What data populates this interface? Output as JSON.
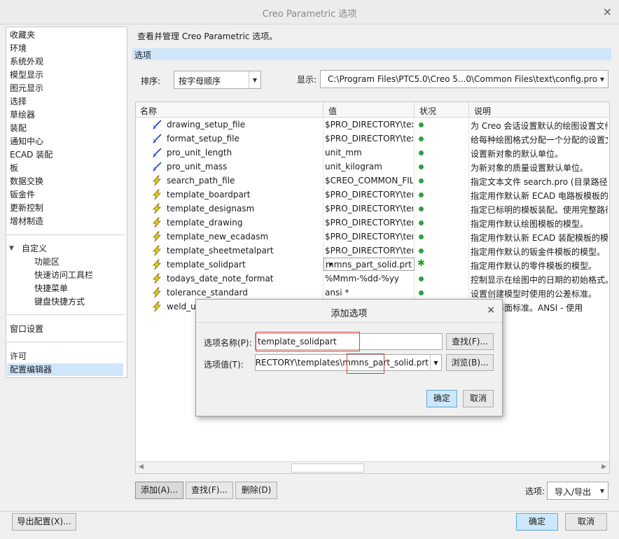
{
  "window": {
    "title": "Creo Parametric 选项",
    "close": "×"
  },
  "nav": {
    "items": [
      "收藏夹",
      "环境",
      "系统外观",
      "模型显示",
      "图元显示",
      "选择",
      "草绘器",
      "装配",
      "通知中心",
      "ECAD 装配",
      "板",
      "数据交换",
      "钣金件",
      "更新控制",
      "增材制造"
    ],
    "custom_group": "自定义",
    "custom_items": [
      "功能区",
      "快速访问工具栏",
      "快捷菜单",
      "键盘快捷方式"
    ],
    "window_settings": "窗口设置",
    "license": "许可",
    "config_editor": "配置编辑器"
  },
  "header": {
    "description": "查看并管理 Creo Parametric 选项。",
    "section": "选项",
    "sort_label": "排序:",
    "sort_value": "按字母顺序",
    "show_label": "显示:",
    "show_value": "C:\\Program Files\\PTC5.0\\Creo 5...0\\Common Files\\text\\config.pro"
  },
  "table": {
    "columns": [
      "名称",
      "值",
      "状况",
      "说明"
    ],
    "rows": [
      {
        "icon": "brush-icon",
        "name": "drawing_setup_file",
        "value": "$PRO_DIRECTORY\\tex",
        "desc": "为 Creo 会话设置默认的绘图设置文件"
      },
      {
        "icon": "brush-icon",
        "name": "format_setup_file",
        "value": "$PRO_DIRECTORY\\tex",
        "desc": "给每种绘图格式分配一个分配的设置文件"
      },
      {
        "icon": "brush-icon",
        "name": "pro_unit_length",
        "value": "unit_mm",
        "desc": "设置新对象的默认单位。"
      },
      {
        "icon": "brush-icon",
        "name": "pro_unit_mass",
        "value": "unit_kilogram",
        "desc": "为新对象的质量设置默认单位。"
      },
      {
        "icon": "lightning-icon",
        "name": "search_path_file",
        "value": "$CREO_COMMON_FIL",
        "desc": "指定文本文件 search.pro (目录路径"
      },
      {
        "icon": "lightning-icon",
        "name": "template_boardpart",
        "value": "$PRO_DIRECTORY\\ten",
        "desc": "指定用作默认新 ECAD 电路板模板的"
      },
      {
        "icon": "lightning-icon",
        "name": "template_designasm",
        "value": "$PRO_DIRECTORY\\ten",
        "desc": "指定已标明的模板装配。使用完整路径"
      },
      {
        "icon": "lightning-icon",
        "name": "template_drawing",
        "value": "$PRO_DIRECTORY\\ten",
        "desc": "指定用作默认绘图模板的模型。"
      },
      {
        "icon": "lightning-icon",
        "name": "template_new_ecadasm",
        "value": "$PRO_DIRECTORY\\ten",
        "desc": "指定用作默认新 ECAD 装配模板的模"
      },
      {
        "icon": "lightning-icon",
        "name": "template_sheetmetalpart",
        "value": "$PRO_DIRECTORY\\ten",
        "desc": "指定用作默认的钣金件模板的模型。"
      },
      {
        "icon": "lightning-icon",
        "name": "template_solidpart",
        "value": "mmns_part_solid.prt",
        "desc": "指定用作默认的零件模板的模型。",
        "editing": true
      },
      {
        "icon": "lightning-icon",
        "name": "todays_date_note_format",
        "value": "%Mmm-%dd-%yy",
        "desc": "控制显示在绘图中的日期的初始格式。"
      },
      {
        "icon": "lightning-icon",
        "name": "tolerance_standard",
        "value": "ansi *",
        "desc": "设置创建模型时使用的公差标准。"
      },
      {
        "icon": "lightning-icon",
        "name": "weld_ui",
        "value": "",
        "desc": "使用户界面标准。ANSI - 使用"
      }
    ]
  },
  "bottom": {
    "add": "添加(A)...",
    "find": "查找(F)...",
    "delete": "删除(D)",
    "options_label": "选项:",
    "options_value": "导入/导出",
    "export": "导出配置(X)...",
    "ok": "确定",
    "cancel": "取消"
  },
  "dialog": {
    "title": "添加选项",
    "name_label": "选项名称(P):",
    "name_value": "template_solidpart",
    "find_button": "查找(F)...",
    "value_label": "选项值(T):",
    "value_value": ")IRECTORY\\templates\\mmns_part_solid.prt",
    "browse_button": "浏览(B)...",
    "ok": "确定",
    "cancel": "取消"
  },
  "colors": {
    "accent": "#cfe6fb",
    "status_green": "#2f9e44",
    "highlight_red": "#e23b3b"
  }
}
